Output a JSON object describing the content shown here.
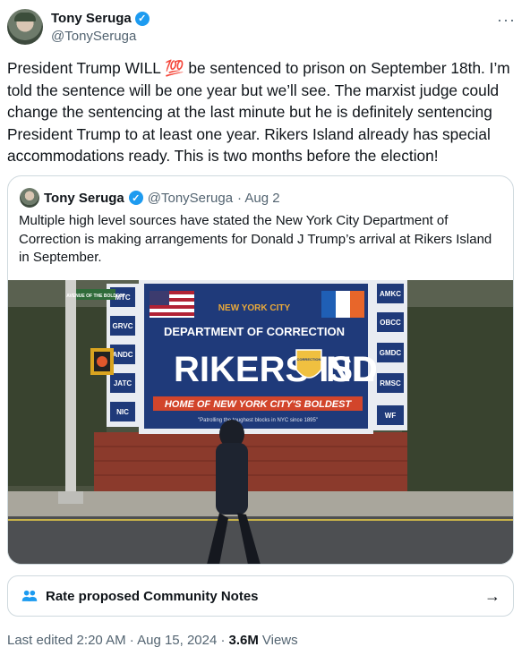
{
  "tweet": {
    "author_name": "Tony Seruga",
    "author_handle": "@TonySeruga",
    "more_icon": "···",
    "text_before_emoji": "President Trump WILL ",
    "emoji": "💯",
    "text_after_emoji": " be sentenced to prison on September 18th. I’m told the sentence will be one year but we’ll see. The marxist judge could change the sentencing at the last minute but he is definitely sentencing President Trump to at least one year. Rikers Island already has special accommodations ready. This is two months before the election!"
  },
  "quoted_tweet": {
    "author_name": "Tony Seruga",
    "author_handle": "@TonySeruga",
    "date": "· Aug 2",
    "text": "Multiple high level sources have stated the New York City Department of Correction is making arrangements for Donald J Trump’s arrival at Rikers Island in September.",
    "image": {
      "sign_department": "DEPARTMENT OF CORRECTION",
      "sign_title_left": "RIKERS ISL",
      "sign_title_right": "ND",
      "sign_tagline": "HOME OF NEW YORK CITY'S BOLDEST",
      "sign_motto": "\"Patrolling the toughest blocks in NYC since 1895\"",
      "sign_city": "NEW YORK CITY",
      "badge_text": "CORRECTION",
      "left_tags": [
        "MTC",
        "GRVC",
        "ANDC",
        "JATC",
        "NIC"
      ],
      "right_tags": [
        "AMKC",
        "OBCC",
        "GMDC",
        "RMSC",
        "WF"
      ],
      "street_sign": "AVENUE OF THE BOLDEST",
      "colors": {
        "sign_blue": "#1f3a7a",
        "tagline_red": "#d2452b",
        "brick": "#8b3a2c",
        "foliage": "#39432f"
      }
    }
  },
  "community_notes": {
    "label": "Rate proposed Community Notes",
    "icon": "people-icon",
    "arrow": "→"
  },
  "meta": {
    "edited": "Last edited 2:20 AM · Aug 15, 2024 ·",
    "views_count": "3.6M",
    "views_label": "Views"
  },
  "colors": {
    "accent": "#1d9bf0",
    "text": "#0f1419",
    "secondary": "#536471",
    "border": "#cfd9de"
  }
}
